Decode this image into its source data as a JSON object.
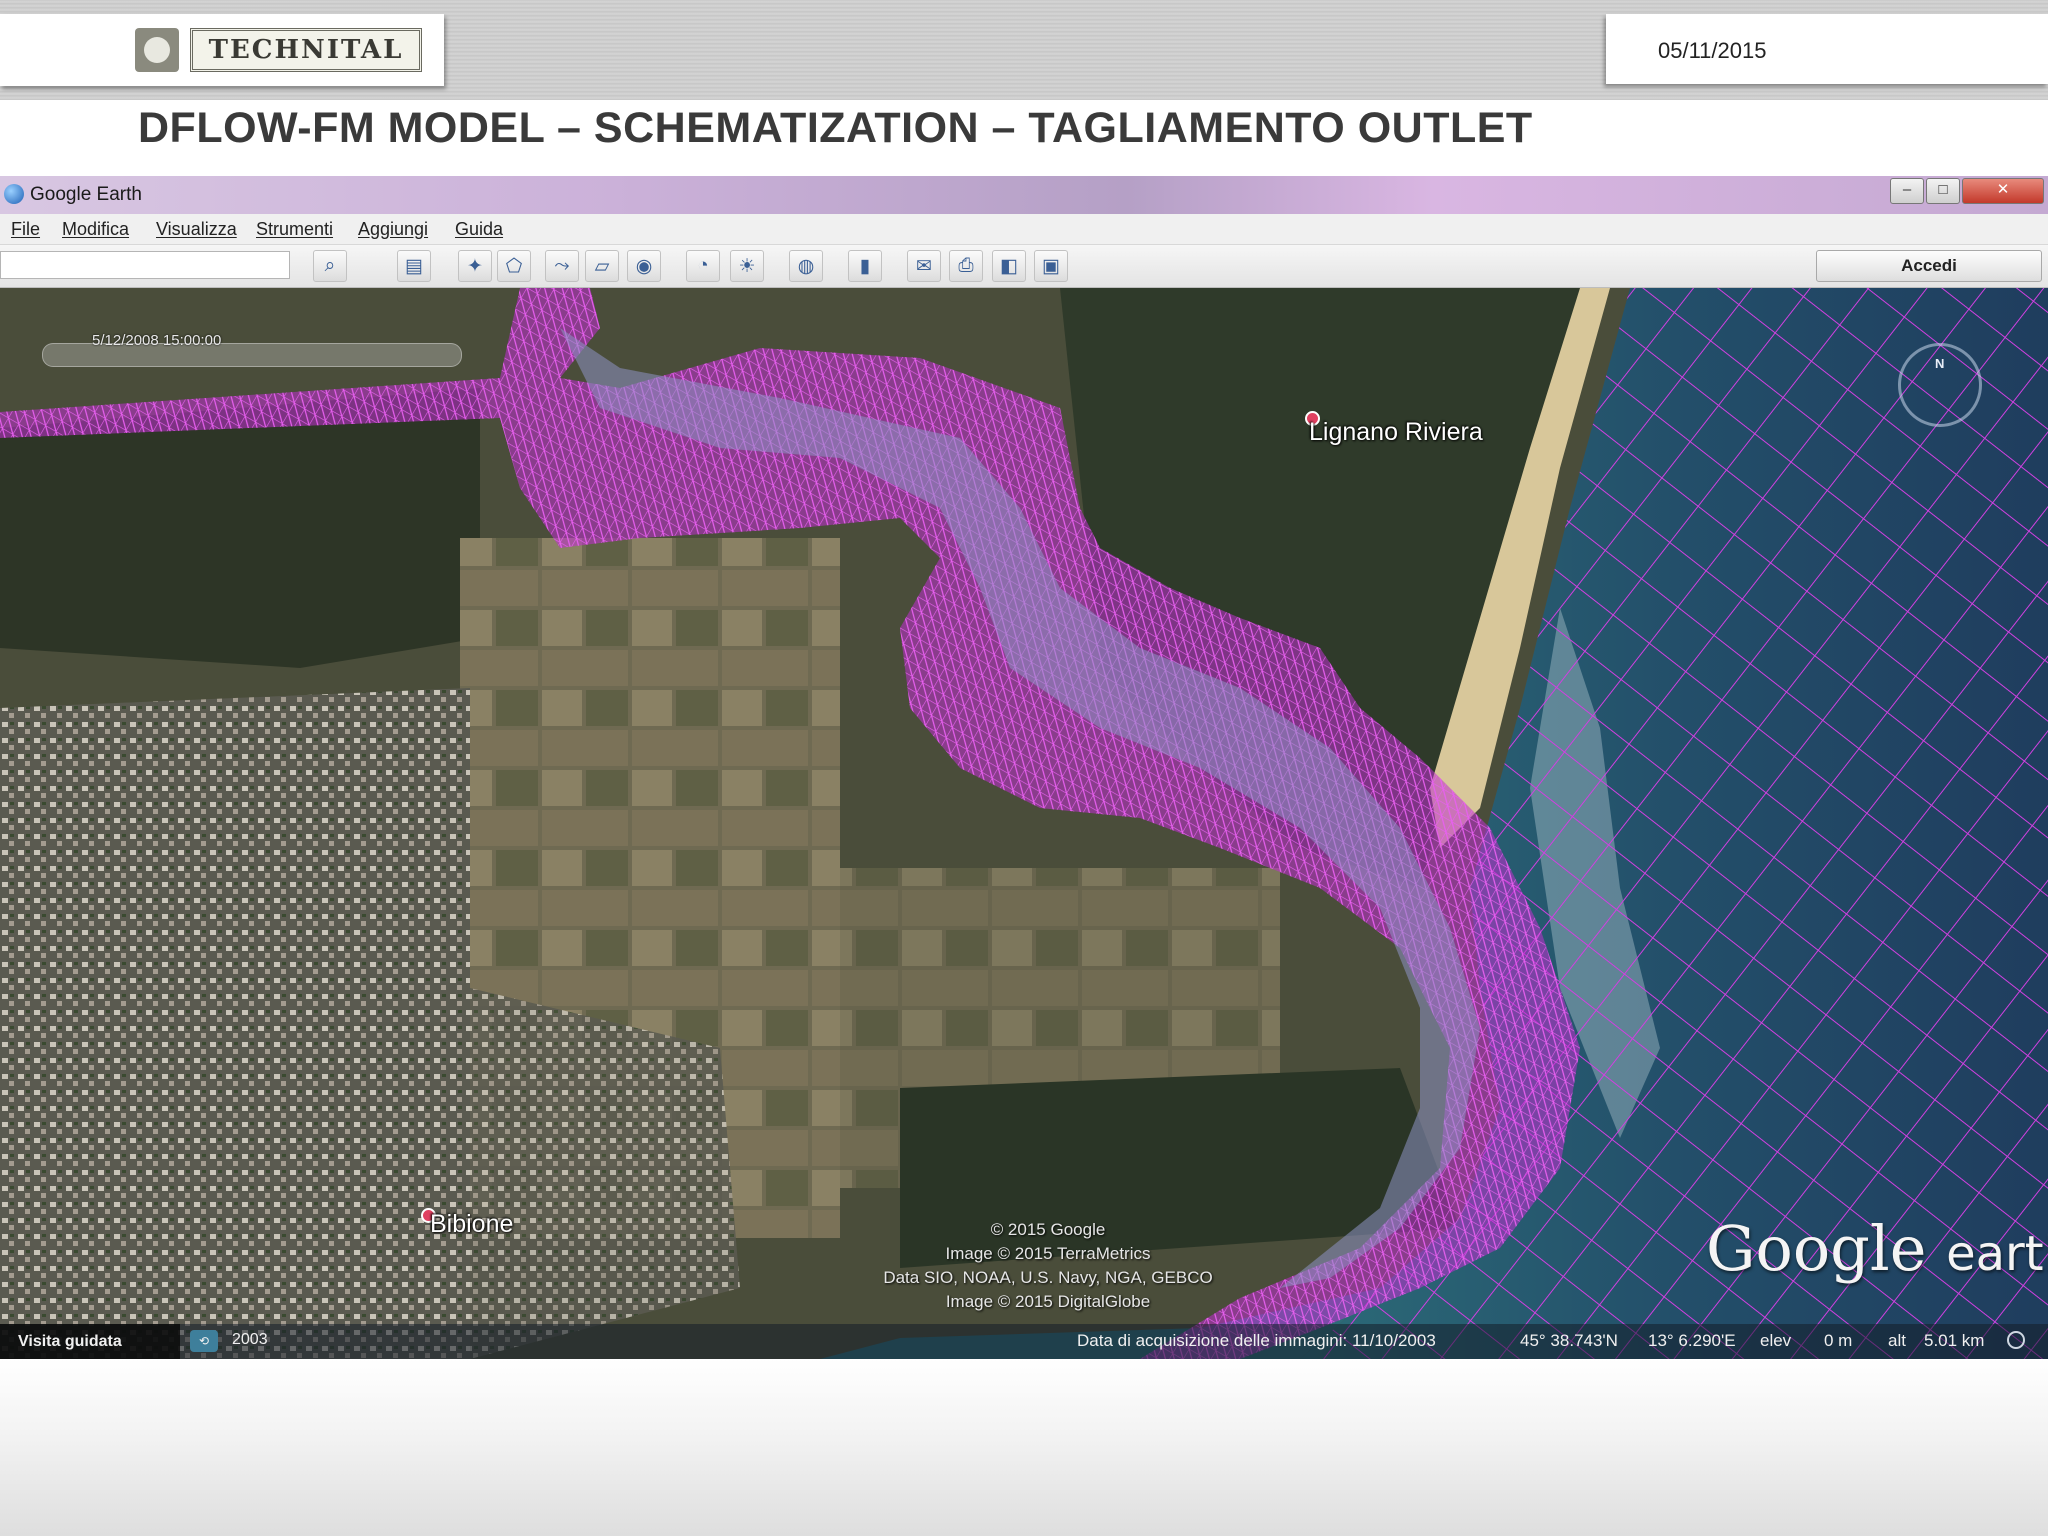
{
  "slide": {
    "logo_text": "TECHNITAL",
    "date": "05/11/2015",
    "title": "DFLOW-FM MODEL – SCHEMATIZATION – TAGLIAMENTO OUTLET"
  },
  "window": {
    "title": "Google Earth",
    "controls": {
      "minimize": "–",
      "maximize": "□",
      "close": "✕"
    }
  },
  "menu": [
    "File",
    "Modifica",
    "Visualizza",
    "Strumenti",
    "Aggiungi",
    "Guida"
  ],
  "toolbar": {
    "search_value": "",
    "buttons": [
      "search-icon",
      "sidebar-icon",
      "placemark-icon",
      "polygon-icon",
      "path-icon",
      "overlay-icon",
      "tour-icon",
      "historical-icon",
      "sunlight-icon",
      "planet-icon",
      "ruler-icon",
      "email-icon",
      "print-icon",
      "maps-icon",
      "save-image-icon"
    ],
    "login_label": "Accedi"
  },
  "map": {
    "timestamp": "5/12/2008  15:00:00",
    "places": [
      "Lignano Riviera",
      "Bibione"
    ],
    "compass_label": "N",
    "credits": [
      "© 2015 Google",
      "Image © 2015 TerraMetrics",
      "Data SIO, NOAA, U.S. Navy, NGA, GEBCO",
      "Image © 2015 DigitalGlobe"
    ],
    "logo_word1": "Google",
    "logo_word2": "earth",
    "mesh_color": "#e040e8"
  },
  "status_bar": {
    "tour_label": "Visita guidata",
    "year": "2003",
    "acquisition": "Data di acquisizione delle immagini: 11/10/2003",
    "lat": "45° 38.743'N",
    "lon": "13° 6.290'E",
    "elev_label": "elev",
    "elev_value": "0 m",
    "alt_label": "alt",
    "alt_value": "5.01 km"
  }
}
